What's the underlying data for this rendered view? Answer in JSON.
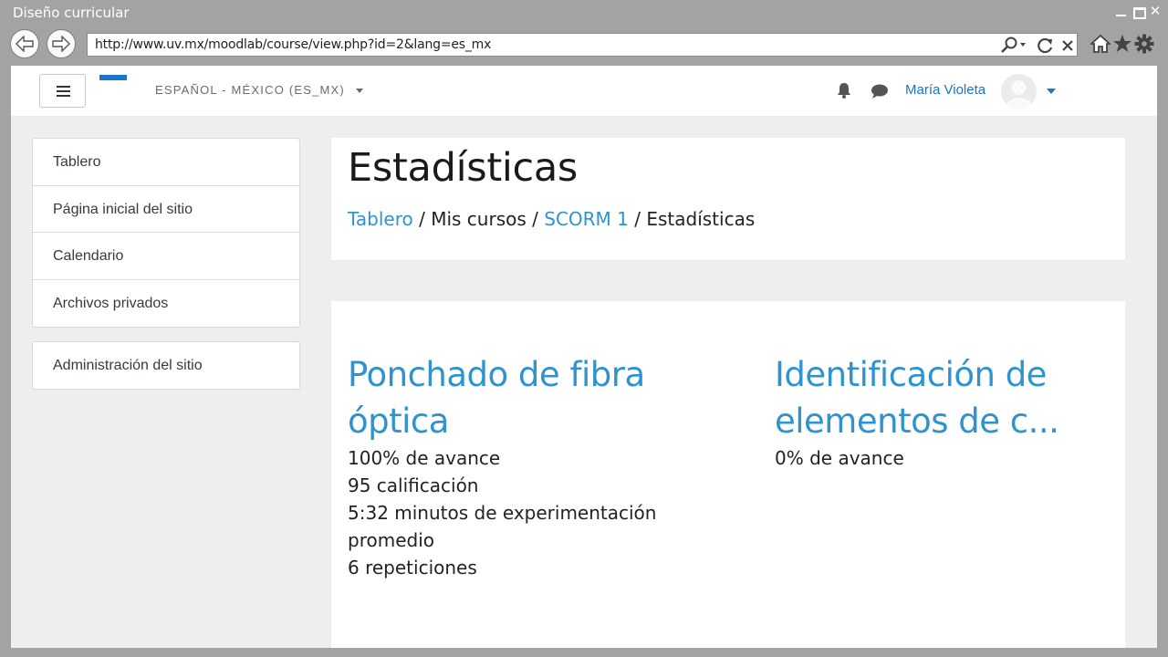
{
  "window": {
    "title": "Diseño curricular",
    "url": "http://www.uv.mx/moodlab/course/view.php?id=2&lang=es_mx"
  },
  "navbar": {
    "language": "ESPAÑOL - MÉXICO (ES_MX)",
    "username": "María Violeta"
  },
  "sidebar": {
    "items": [
      {
        "label": "Tablero"
      },
      {
        "label": "Página inicial del sitio"
      },
      {
        "label": "Calendario"
      },
      {
        "label": "Archivos privados"
      }
    ],
    "admin_label": "Administración del sitio"
  },
  "header": {
    "title": "Estadísticas",
    "breadcrumb": {
      "home": "Tablero",
      "sep": "/",
      "courses": "Mis cursos",
      "scorm": "SCORM 1",
      "current": "Estadísticas"
    }
  },
  "stats": {
    "courses": [
      {
        "title_line1": "Ponchado de fibra",
        "title_line2": "óptica",
        "progress": "100% de avance",
        "grade": "95 calificación",
        "time_line1": "5:32 minutos de experimentación",
        "time_line2": "promedio",
        "repetitions": "6 repeticiones"
      },
      {
        "title_line1": "Identificación de",
        "title_line2": "elementos de c...",
        "progress": "0% de avance"
      }
    ]
  },
  "colors": {
    "accent": "#1a74c8",
    "link": "#2f93cf",
    "page_bg": "#eceef0",
    "chrome": "#a3a3a3"
  }
}
